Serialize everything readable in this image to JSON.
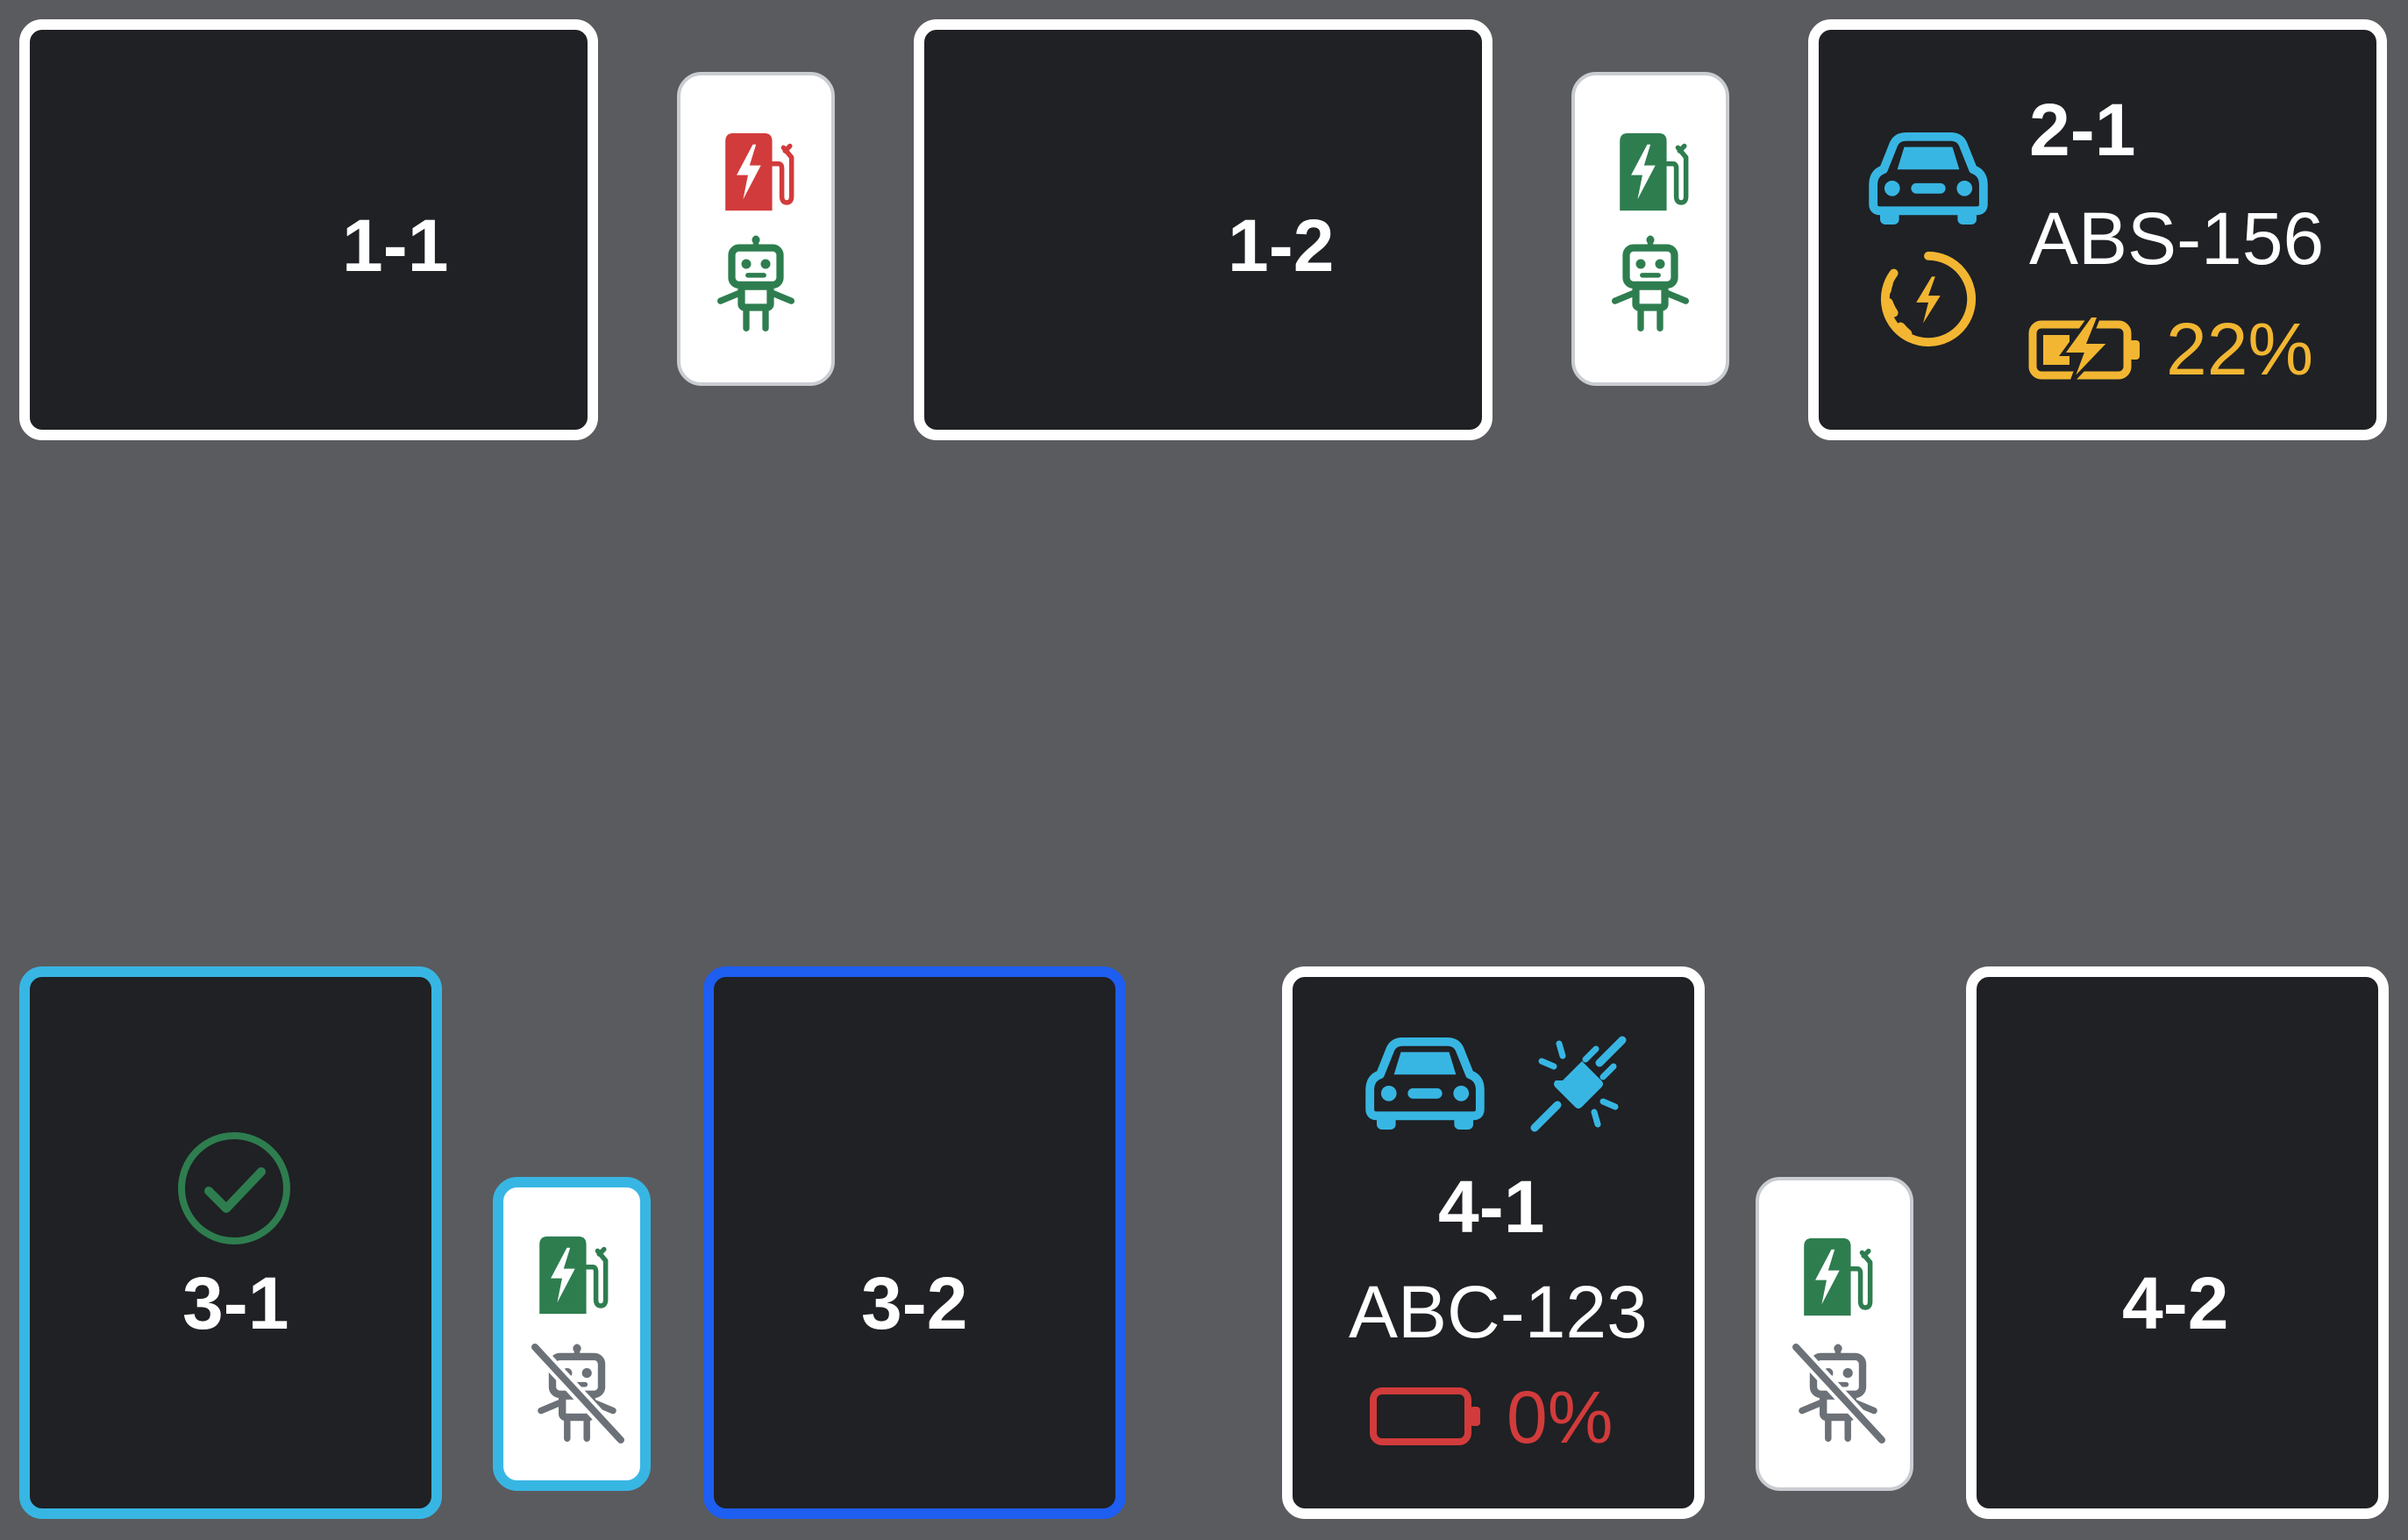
{
  "colors": {
    "background": "#5a5b5e",
    "spot_fill": "#1f2124",
    "spot_border": "#ffffff",
    "selected_light": "#38b6e3",
    "selected_blue": "#1e5ef0",
    "charger_ok": "#2e7d4f",
    "charger_fault": "#d23b3b",
    "robot_disabled": "#6c7178",
    "car": "#38b6e3",
    "warning": "#f2b632",
    "danger": "#d23b3b"
  },
  "spots": {
    "s11": {
      "label": "1-1"
    },
    "s12": {
      "label": "1-2"
    },
    "s21": {
      "label": "2-1",
      "plate": "ABS-156",
      "battery": "22%",
      "icons": [
        "car-icon",
        "charging-timer-icon",
        "battery-charging-icon"
      ]
    },
    "s31": {
      "label": "3-1",
      "icons": [
        "check-circle-icon"
      ]
    },
    "s32": {
      "label": "3-2"
    },
    "s41": {
      "label": "4-1",
      "plate": "ABC-123",
      "battery": "0%",
      "icons": [
        "car-icon",
        "plug-disconnected-icon",
        "battery-empty-icon"
      ]
    },
    "s42": {
      "label": "4-2"
    }
  },
  "chargers": {
    "c1": {
      "status": "fault",
      "icons": [
        "ev-charger-icon",
        "robot-icon"
      ]
    },
    "c2": {
      "status": "ok",
      "icons": [
        "ev-charger-icon",
        "robot-icon"
      ]
    },
    "c3": {
      "status": "ok",
      "icons": [
        "ev-charger-icon",
        "robot-off-icon"
      ]
    },
    "c4": {
      "status": "ok",
      "icons": [
        "ev-charger-icon",
        "robot-off-icon"
      ]
    }
  }
}
